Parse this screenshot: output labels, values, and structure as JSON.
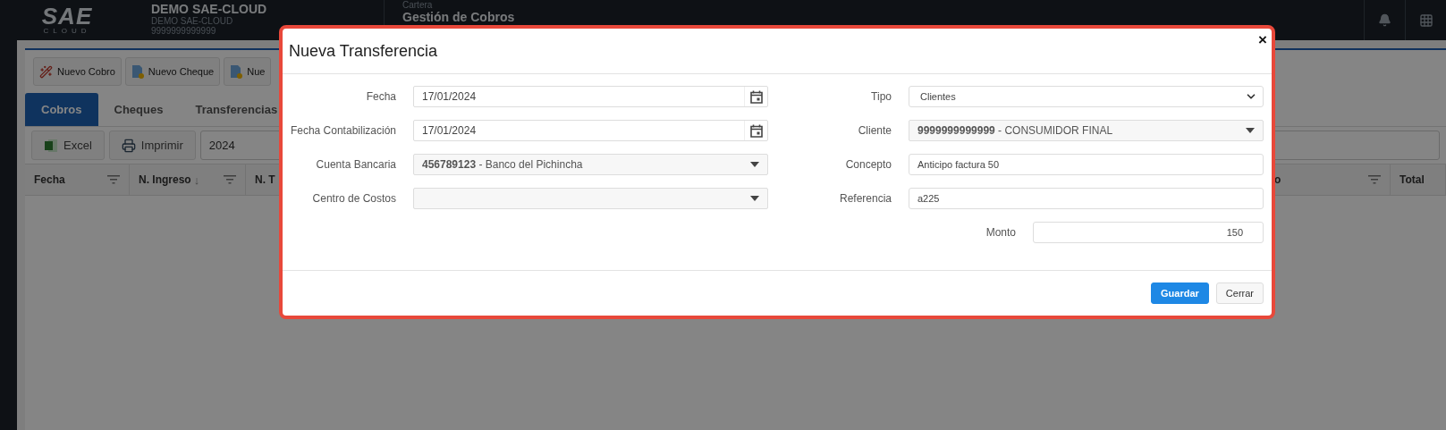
{
  "header": {
    "logo": {
      "mark": "SAE",
      "sub": "CLOUD"
    },
    "company": {
      "name": "DEMO SAE-CLOUD",
      "subtitle": "DEMO SAE-CLOUD",
      "ruc": "9999999999999"
    },
    "module": {
      "section": "Cartera",
      "title": "Gestión de Cobros"
    }
  },
  "actions": [
    {
      "label": "Nuevo Cobro",
      "kind": "wand"
    },
    {
      "label": "Nuevo Cheque",
      "kind": "document"
    },
    {
      "label": "Nue",
      "kind": "document"
    }
  ],
  "tabs": [
    {
      "label": "Cobros",
      "selected": true
    },
    {
      "label": "Cheques",
      "selected": false
    },
    {
      "label": "Transferencias",
      "selected": false
    }
  ],
  "list_toolbar": {
    "buttons": [
      {
        "label": "Excel",
        "kind": "excel"
      },
      {
        "label": "Imprimir",
        "kind": "print"
      }
    ],
    "year": "2024"
  },
  "table": {
    "columns": [
      {
        "label": "Fecha",
        "filter": true
      },
      {
        "label": "N. Ingreso",
        "sort": "↓",
        "filter": true
      },
      {
        "label": "N. T",
        "filter": false
      },
      {
        "label": "o",
        "filter": true
      },
      {
        "label": "Total",
        "filter": false
      }
    ]
  },
  "dialog": {
    "title": "Nueva Transferencia",
    "close": "×",
    "left_fields": [
      {
        "label": "Fecha",
        "kind": "date",
        "value": "17/01/2024"
      },
      {
        "label": "Fecha Contabilización",
        "kind": "date",
        "value": "17/01/2024"
      },
      {
        "label": "Cuenta Bancaria",
        "kind": "combo",
        "value": "**456789123** - Banco del Pichincha"
      },
      {
        "label": "Centro de Costos",
        "kind": "combo"
      }
    ],
    "right_fields": [
      {
        "label": "Tipo",
        "kind": "select",
        "value": "Clientes"
      },
      {
        "label": "Cliente",
        "kind": "combo",
        "value": "**9999999999999** - CONSUMIDOR FINAL"
      },
      {
        "label": "Concepto",
        "kind": "text",
        "value": "Anticipo factura 50"
      },
      {
        "label": "Referencia",
        "kind": "text",
        "value": "a225"
      },
      {
        "label": "Monto",
        "kind": "amount",
        "value": "150"
      }
    ],
    "buttons": [
      {
        "label": "Guardar",
        "primary": true
      },
      {
        "label": "Cerrar",
        "primary": false
      }
    ]
  }
}
